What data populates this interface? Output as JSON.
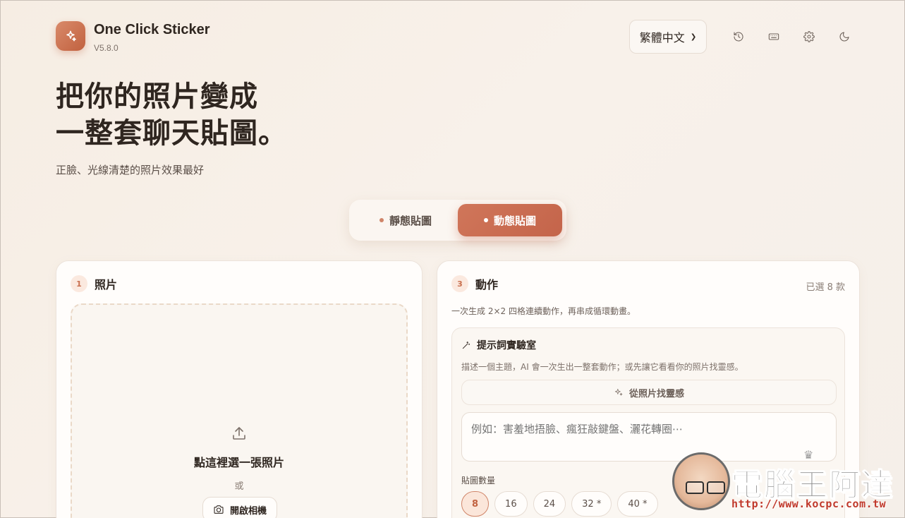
{
  "app": {
    "logo_icon": "sparkle-icon",
    "title": "One Click Sticker",
    "version": "V5.8.0"
  },
  "topbar": {
    "language": "繁體中文",
    "icons": [
      "history-icon",
      "keyboard-icon",
      "gear-icon",
      "moon-icon"
    ]
  },
  "hero": {
    "title_line1": "把你的照片變成",
    "title_line2": "一整套聊天貼圖。",
    "subtitle": "正臉、光線清楚的照片效果最好"
  },
  "mode": {
    "static_label": "靜態貼圖",
    "animated_label": "動態貼圖",
    "selected": "animated"
  },
  "photo_card": {
    "step": "1",
    "title": "照片",
    "drop_title": "點這裡選一張照片",
    "or_text": "或",
    "camera_button": "開啟相機"
  },
  "action_card": {
    "step": "3",
    "title": "動作",
    "selected_count": "已選 8 款",
    "description": "一次生成 2×2 四格連續動作，再串成循環動畫。",
    "lab": {
      "title": "提示詞實驗室",
      "description": "描述一個主題，AI 會一次生出一整套動作；或先讓它看看你的照片找靈感。",
      "inspire_button": "從照片找靈感",
      "prompt_placeholder": "例如：害羞地捂臉、瘋狂敲鍵盤、灑花轉圈⋯",
      "count_label": "貼圖數量",
      "count_options": [
        "8",
        "16",
        "24",
        "32 *",
        "40 *"
      ],
      "count_selected": "8"
    }
  },
  "watermark": {
    "title": "電腦王阿達",
    "url": "http://www.kocpc.com.tw"
  }
}
